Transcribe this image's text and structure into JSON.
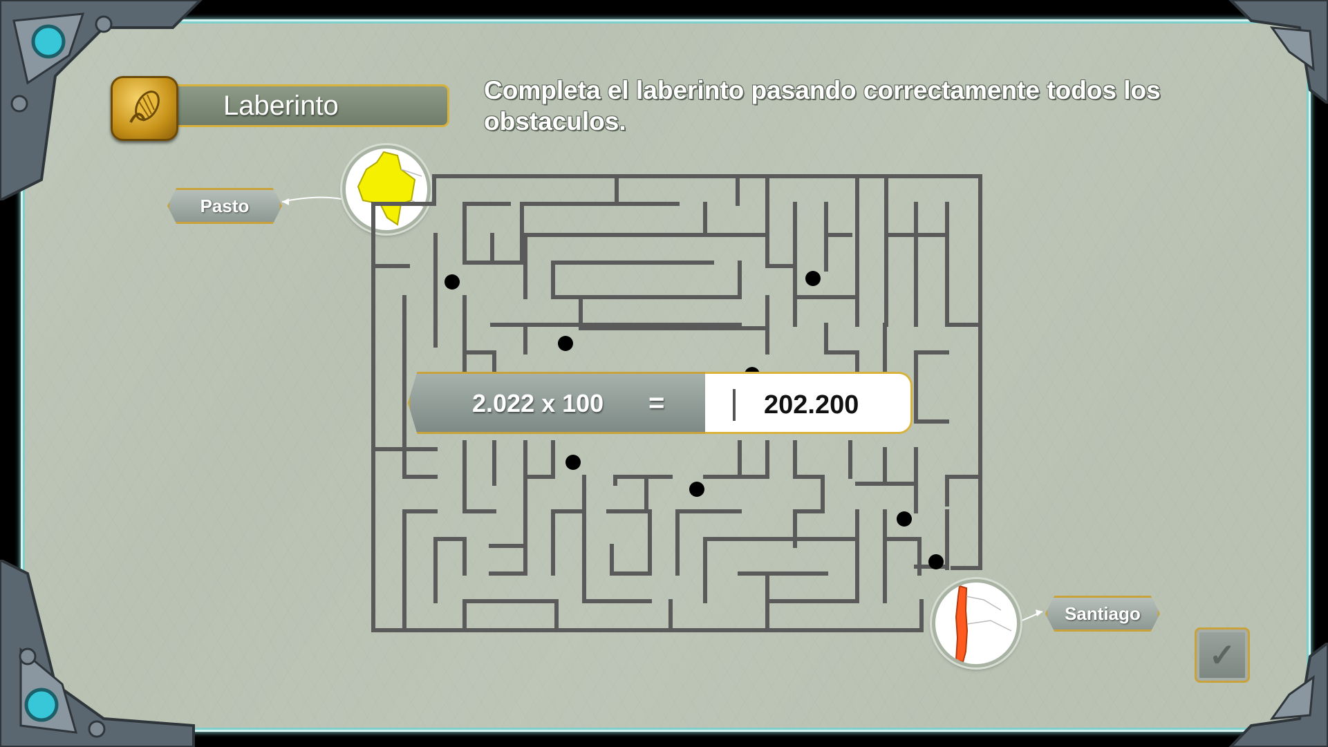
{
  "game": {
    "title": "Laberinto",
    "instruction": "Completa el laberinto pasando correctamente todos los obstaculos.",
    "start_city": "Pasto",
    "end_city": "Santiago",
    "start_country_color": "#f4f000",
    "end_country_color": "#ff5a1f"
  },
  "equation": {
    "expression": "2.022 x 100",
    "sign": "=",
    "answer": "202.200"
  },
  "icons": {
    "badge": "corn-icon",
    "check": "check-icon",
    "check_glyph": "✓"
  },
  "colors": {
    "maze_wall": "#5a5a5a",
    "background": "#b9c2b3",
    "accent_gold": "#d8b23a"
  }
}
